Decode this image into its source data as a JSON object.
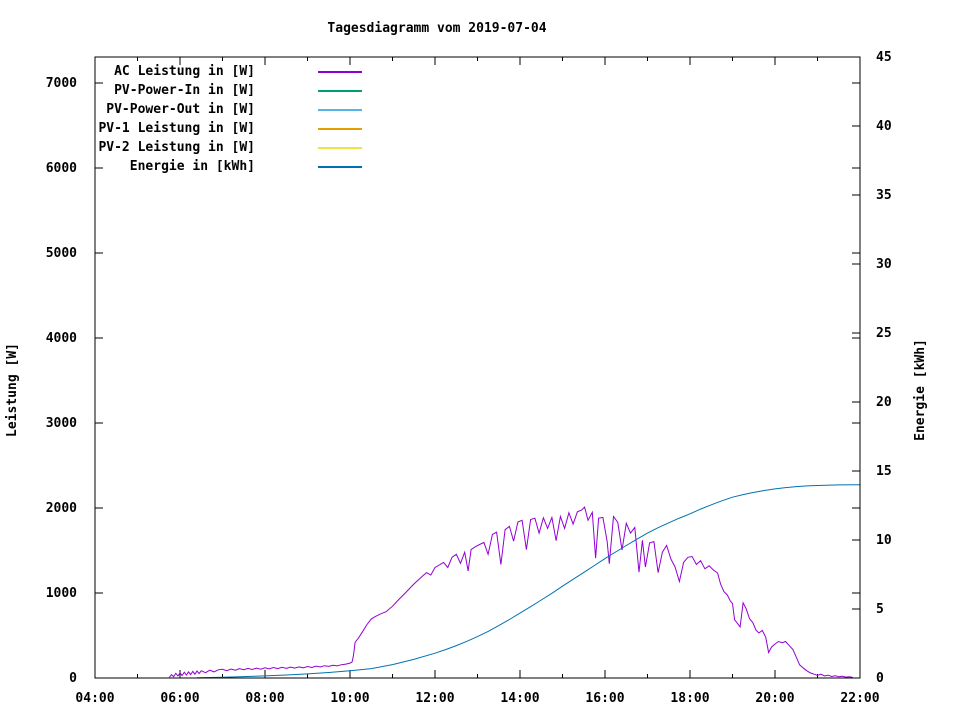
{
  "title": "Tagesdiagramm vom 2019-07-04",
  "chart_data": {
    "type": "line",
    "title": "Tagesdiagramm vom 2019-07-04",
    "x_axis": {
      "tick_labels": [
        "04:00",
        "06:00",
        "08:00",
        "10:00",
        "12:00",
        "14:00",
        "16:00",
        "18:00",
        "20:00",
        "22:00"
      ],
      "tick_hours": [
        4,
        6,
        8,
        10,
        12,
        14,
        16,
        18,
        20,
        22
      ],
      "minor_tick_hours": [
        5,
        7,
        9,
        11,
        13,
        15,
        17,
        19,
        21
      ],
      "range_hours": [
        4,
        22
      ]
    },
    "y_left_axis": {
      "label": "Leistung [W]",
      "tick_values": [
        0,
        1000,
        2000,
        3000,
        4000,
        5000,
        6000,
        7000
      ],
      "range": [
        0,
        7300
      ],
      "grid": false
    },
    "y_right_axis": {
      "label": "Energie [kWh]",
      "tick_values": [
        0,
        5,
        10,
        15,
        20,
        25,
        30,
        35,
        40,
        45
      ],
      "range": [
        0,
        45
      ]
    },
    "legend_position": "top-left-inside",
    "series": [
      {
        "name": "AC Leistung in [W]",
        "color": "#9400d3",
        "axis": "left",
        "visible": true,
        "points": [
          [
            5.75,
            8
          ],
          [
            5.8,
            40
          ],
          [
            5.85,
            15
          ],
          [
            5.9,
            55
          ],
          [
            5.95,
            25
          ],
          [
            6.0,
            60
          ],
          [
            6.05,
            30
          ],
          [
            6.1,
            68
          ],
          [
            6.15,
            35
          ],
          [
            6.2,
            72
          ],
          [
            6.25,
            40
          ],
          [
            6.3,
            78
          ],
          [
            6.35,
            45
          ],
          [
            6.4,
            82
          ],
          [
            6.45,
            52
          ],
          [
            6.5,
            86
          ],
          [
            6.6,
            62
          ],
          [
            6.7,
            92
          ],
          [
            6.8,
            72
          ],
          [
            6.9,
            96
          ],
          [
            7.0,
            102
          ],
          [
            7.1,
            86
          ],
          [
            7.2,
            106
          ],
          [
            7.3,
            92
          ],
          [
            7.4,
            110
          ],
          [
            7.5,
            98
          ],
          [
            7.6,
            113
          ],
          [
            7.7,
            100
          ],
          [
            7.8,
            116
          ],
          [
            7.9,
            104
          ],
          [
            8.0,
            120
          ],
          [
            8.1,
            108
          ],
          [
            8.2,
            123
          ],
          [
            8.3,
            111
          ],
          [
            8.4,
            126
          ],
          [
            8.5,
            114
          ],
          [
            8.6,
            128
          ],
          [
            8.7,
            117
          ],
          [
            8.8,
            131
          ],
          [
            8.9,
            120
          ],
          [
            9.0,
            135
          ],
          [
            9.1,
            124
          ],
          [
            9.2,
            140
          ],
          [
            9.3,
            129
          ],
          [
            9.4,
            145
          ],
          [
            9.5,
            136
          ],
          [
            9.6,
            150
          ],
          [
            9.7,
            142
          ],
          [
            9.8,
            156
          ],
          [
            9.9,
            163
          ],
          [
            10.0,
            175
          ],
          [
            10.05,
            190
          ],
          [
            10.08,
            260
          ],
          [
            10.12,
            420
          ],
          [
            10.2,
            470
          ],
          [
            10.3,
            550
          ],
          [
            10.4,
            630
          ],
          [
            10.5,
            695
          ],
          [
            10.6,
            725
          ],
          [
            10.7,
            750
          ],
          [
            10.85,
            780
          ],
          [
            11.0,
            845
          ],
          [
            11.15,
            925
          ],
          [
            11.3,
            1000
          ],
          [
            11.5,
            1105
          ],
          [
            11.7,
            1195
          ],
          [
            11.8,
            1240
          ],
          [
            11.9,
            1210
          ],
          [
            12.0,
            1300
          ],
          [
            12.1,
            1330
          ],
          [
            12.2,
            1360
          ],
          [
            12.3,
            1300
          ],
          [
            12.4,
            1420
          ],
          [
            12.5,
            1455
          ],
          [
            12.6,
            1350
          ],
          [
            12.7,
            1480
          ],
          [
            12.78,
            1260
          ],
          [
            12.85,
            1510
          ],
          [
            12.95,
            1545
          ],
          [
            13.05,
            1570
          ],
          [
            13.15,
            1595
          ],
          [
            13.25,
            1455
          ],
          [
            13.35,
            1690
          ],
          [
            13.45,
            1715
          ],
          [
            13.55,
            1335
          ],
          [
            13.65,
            1745
          ],
          [
            13.75,
            1785
          ],
          [
            13.85,
            1610
          ],
          [
            13.95,
            1835
          ],
          [
            14.05,
            1855
          ],
          [
            14.15,
            1510
          ],
          [
            14.25,
            1865
          ],
          [
            14.35,
            1880
          ],
          [
            14.45,
            1705
          ],
          [
            14.55,
            1885
          ],
          [
            14.65,
            1760
          ],
          [
            14.75,
            1890
          ],
          [
            14.85,
            1615
          ],
          [
            14.95,
            1900
          ],
          [
            15.05,
            1760
          ],
          [
            15.15,
            1945
          ],
          [
            15.25,
            1810
          ],
          [
            15.35,
            1955
          ],
          [
            15.45,
            1975
          ],
          [
            15.52,
            2010
          ],
          [
            15.6,
            1855
          ],
          [
            15.7,
            1950
          ],
          [
            15.78,
            1410
          ],
          [
            15.85,
            1880
          ],
          [
            15.95,
            1890
          ],
          [
            16.05,
            1610
          ],
          [
            16.1,
            1345
          ],
          [
            16.2,
            1900
          ],
          [
            16.3,
            1830
          ],
          [
            16.4,
            1505
          ],
          [
            16.5,
            1820
          ],
          [
            16.6,
            1705
          ],
          [
            16.7,
            1770
          ],
          [
            16.8,
            1245
          ],
          [
            16.88,
            1620
          ],
          [
            16.95,
            1305
          ],
          [
            17.05,
            1590
          ],
          [
            17.15,
            1605
          ],
          [
            17.25,
            1240
          ],
          [
            17.35,
            1480
          ],
          [
            17.45,
            1560
          ],
          [
            17.55,
            1400
          ],
          [
            17.65,
            1305
          ],
          [
            17.75,
            1135
          ],
          [
            17.85,
            1360
          ],
          [
            17.95,
            1420
          ],
          [
            18.05,
            1430
          ],
          [
            18.15,
            1335
          ],
          [
            18.25,
            1380
          ],
          [
            18.35,
            1285
          ],
          [
            18.45,
            1320
          ],
          [
            18.55,
            1270
          ],
          [
            18.65,
            1235
          ],
          [
            18.72,
            1105
          ],
          [
            18.8,
            1015
          ],
          [
            18.88,
            975
          ],
          [
            18.95,
            905
          ],
          [
            19.0,
            875
          ],
          [
            19.05,
            685
          ],
          [
            19.12,
            640
          ],
          [
            19.18,
            600
          ],
          [
            19.25,
            885
          ],
          [
            19.32,
            815
          ],
          [
            19.4,
            700
          ],
          [
            19.48,
            650
          ],
          [
            19.55,
            565
          ],
          [
            19.62,
            530
          ],
          [
            19.7,
            560
          ],
          [
            19.78,
            480
          ],
          [
            19.85,
            300
          ],
          [
            19.92,
            365
          ],
          [
            20.0,
            400
          ],
          [
            20.08,
            430
          ],
          [
            20.17,
            415
          ],
          [
            20.25,
            430
          ],
          [
            20.33,
            385
          ],
          [
            20.42,
            335
          ],
          [
            20.5,
            245
          ],
          [
            20.58,
            155
          ],
          [
            20.67,
            115
          ],
          [
            20.75,
            85
          ],
          [
            20.83,
            60
          ],
          [
            20.92,
            45
          ],
          [
            21.0,
            32
          ],
          [
            21.08,
            45
          ],
          [
            21.17,
            24
          ],
          [
            21.25,
            34
          ],
          [
            21.33,
            18
          ],
          [
            21.42,
            26
          ],
          [
            21.5,
            14
          ],
          [
            21.58,
            20
          ],
          [
            21.67,
            10
          ],
          [
            21.75,
            14
          ],
          [
            21.83,
            6
          ]
        ]
      },
      {
        "name": "PV-Power-In in [W]",
        "color": "#009e73",
        "axis": "left",
        "visible": false,
        "points": []
      },
      {
        "name": "PV-Power-Out in [W]",
        "color": "#56b4e9",
        "axis": "left",
        "visible": false,
        "points": []
      },
      {
        "name": "PV-1 Leistung in [W]",
        "color": "#e69f00",
        "axis": "left",
        "visible": false,
        "points": []
      },
      {
        "name": "PV-2 Leistung in [W]",
        "color": "#f0e442",
        "axis": "left",
        "visible": false,
        "points": []
      },
      {
        "name": "Energie in [kWh]",
        "color": "#0072b2",
        "axis": "right",
        "visible": true,
        "points": [
          [
            6.4,
            0.02
          ],
          [
            7.0,
            0.05
          ],
          [
            7.5,
            0.1
          ],
          [
            8.0,
            0.15
          ],
          [
            8.5,
            0.22
          ],
          [
            9.0,
            0.3
          ],
          [
            9.5,
            0.4
          ],
          [
            10.0,
            0.52
          ],
          [
            10.5,
            0.68
          ],
          [
            11.0,
            0.97
          ],
          [
            11.5,
            1.35
          ],
          [
            12.0,
            1.8
          ],
          [
            12.25,
            2.06
          ],
          [
            12.5,
            2.35
          ],
          [
            12.75,
            2.66
          ],
          [
            13.0,
            3.0
          ],
          [
            13.25,
            3.38
          ],
          [
            13.5,
            3.8
          ],
          [
            13.75,
            4.24
          ],
          [
            14.0,
            4.7
          ],
          [
            14.25,
            5.17
          ],
          [
            14.5,
            5.65
          ],
          [
            14.75,
            6.14
          ],
          [
            15.0,
            6.65
          ],
          [
            15.25,
            7.15
          ],
          [
            15.5,
            7.65
          ],
          [
            15.75,
            8.15
          ],
          [
            16.0,
            8.65
          ],
          [
            16.25,
            9.13
          ],
          [
            16.5,
            9.6
          ],
          [
            16.75,
            10.06
          ],
          [
            17.0,
            10.5
          ],
          [
            17.25,
            10.89
          ],
          [
            17.5,
            11.25
          ],
          [
            17.75,
            11.59
          ],
          [
            18.0,
            11.9
          ],
          [
            18.25,
            12.24
          ],
          [
            18.5,
            12.55
          ],
          [
            18.75,
            12.84
          ],
          [
            19.0,
            13.1
          ],
          [
            19.25,
            13.29
          ],
          [
            19.5,
            13.45
          ],
          [
            19.75,
            13.59
          ],
          [
            20.0,
            13.7
          ],
          [
            20.25,
            13.8
          ],
          [
            20.5,
            13.87
          ],
          [
            20.75,
            13.92
          ],
          [
            21.0,
            13.95
          ],
          [
            21.5,
            13.99
          ],
          [
            22.0,
            14.0
          ]
        ]
      }
    ]
  }
}
